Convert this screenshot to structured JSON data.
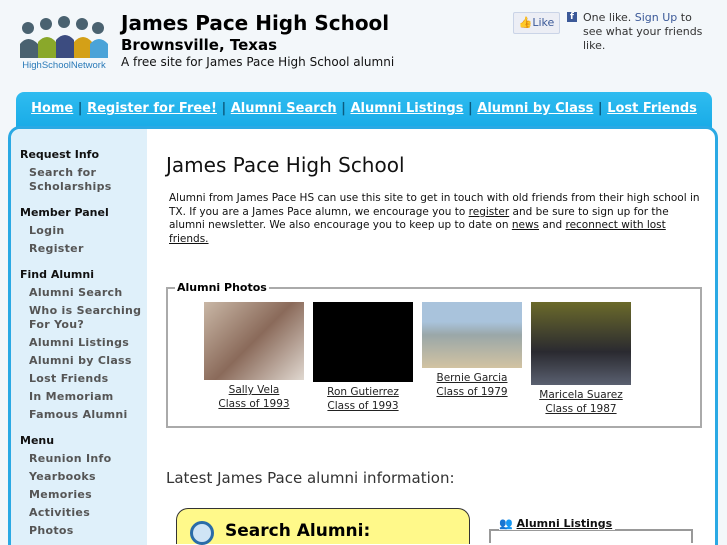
{
  "header": {
    "logo_text": "HighSchoolNetwork",
    "title": "James Pace High School",
    "city": "Brownsville, Texas",
    "tagline": "A free site for James Pace High School alumni"
  },
  "facebook": {
    "like": "Like",
    "text_pre": "One like.",
    "signup": "Sign Up",
    "text_post": "to see what your friends like."
  },
  "nav": [
    "Home",
    "Register for Free!",
    "Alumni Search",
    "Alumni Listings",
    "Alumni by Class",
    "Lost Friends"
  ],
  "sidebar": [
    {
      "heading": "Request Info",
      "items": [
        "Search for Scholarships"
      ]
    },
    {
      "heading": "Member Panel",
      "items": [
        "Login",
        "Register"
      ]
    },
    {
      "heading": "Find Alumni",
      "items": [
        "Alumni Search",
        "Who is Searching For You?",
        "Alumni Listings",
        "Alumni by Class",
        "Lost Friends",
        "In Memoriam",
        "Famous Alumni"
      ]
    },
    {
      "heading": "Menu",
      "items": [
        "Reunion Info",
        "Yearbooks",
        "Memories",
        "Activities",
        "Photos"
      ]
    }
  ],
  "main": {
    "title": "James Pace High School",
    "intro": {
      "p1": "Alumni from James Pace HS can use this site to get in touch with old friends from their high school in TX. If you are a James Pace alumn, we encourage you to ",
      "l1": "register",
      "p2": " and be sure to sign up for the alumni newsletter. We also encourage you to keep up to date on ",
      "l2": "news",
      "p3": " and ",
      "l3": "reconnect with lost friends."
    },
    "photos_legend": "Alumni Photos",
    "photos": [
      {
        "name": "Sally Vela",
        "class": "Class of 1993"
      },
      {
        "name": "Ron Gutierrez",
        "class": "Class of 1993"
      },
      {
        "name": "Bernie Garcia",
        "class": "Class of 1979"
      },
      {
        "name": "Maricela Suarez",
        "class": "Class of 1987"
      }
    ],
    "latest": "Latest James Pace alumni information:",
    "search_title": "Search Alumni:",
    "listings_title": "Alumni Listings"
  }
}
